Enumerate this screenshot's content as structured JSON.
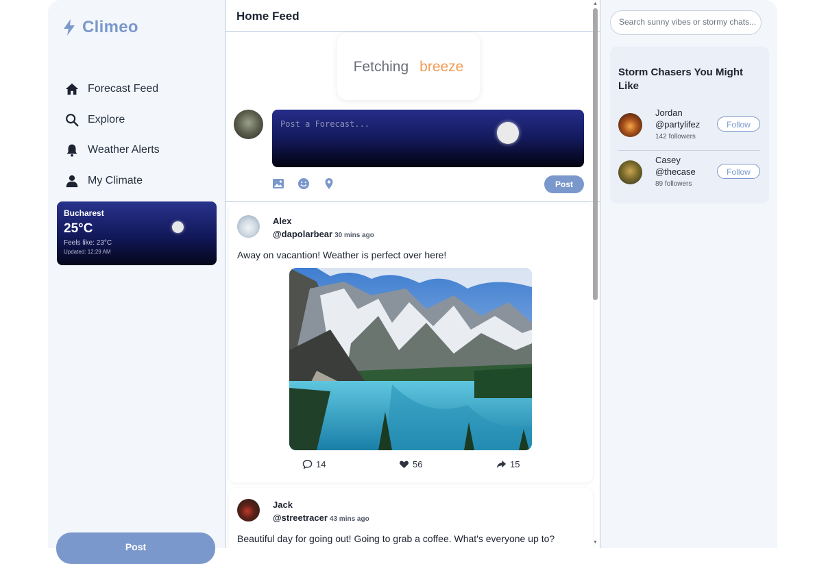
{
  "app": {
    "name": "Climeo",
    "brand_color": "#7b98cc"
  },
  "sidebar": {
    "items": [
      {
        "label": "Forecast Feed",
        "icon": "home-icon"
      },
      {
        "label": "Explore",
        "icon": "search-icon"
      },
      {
        "label": "Weather Alerts",
        "icon": "bell-icon"
      },
      {
        "label": "My Climate",
        "icon": "user-icon"
      }
    ],
    "weather": {
      "city": "Bucharest",
      "temp": "25°C",
      "feels": "Feels like: 23°C",
      "updated": "Updated: 12:29 AM"
    },
    "post_label": "Post"
  },
  "main": {
    "title": "Home Feed",
    "loader": {
      "word1": "Fetching",
      "word2": "breeze"
    },
    "composer": {
      "placeholder": "Post a Forecast...",
      "post_label": "Post"
    },
    "posts": [
      {
        "name": "Alex",
        "handle": "@dapolarbear",
        "time": "30 mins ago",
        "text": "Away on vacantion! Weather is perfect over here!",
        "comments": "14",
        "likes": "56",
        "shares": "15"
      },
      {
        "name": "Jack",
        "handle": "@streetracer",
        "time": "43 mins ago",
        "text": "Beautiful day for going out! Going to grab a coffee. What's everyone up to?"
      }
    ]
  },
  "right": {
    "search_placeholder": "Search sunny vibes or stormy chats...",
    "suggest_title": "Storm Chasers You Might Like",
    "suggestions": [
      {
        "name": "Jordan",
        "handle": "@partylifez",
        "followers": "142 followers",
        "button": "Follow"
      },
      {
        "name": "Casey",
        "handle": "@thecase",
        "followers": "89 followers",
        "button": "Follow"
      }
    ]
  }
}
